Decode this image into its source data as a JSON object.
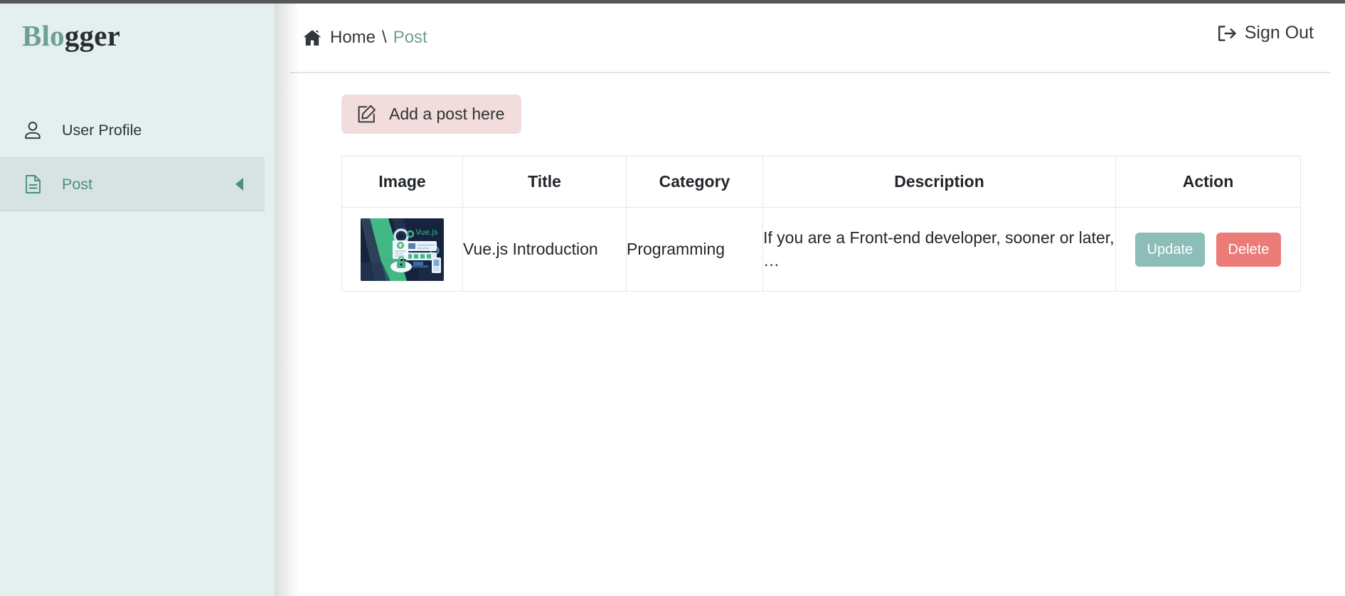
{
  "app": {
    "brand_accent": "Blo",
    "brand_rest": "gger",
    "accent_color": "#6f9e97",
    "sidebar_bg": "#e4f0ee",
    "active_item_bg": "#d7e3e1"
  },
  "sidebar": {
    "items": [
      {
        "label": "User Profile",
        "icon": "user-icon",
        "active": false
      },
      {
        "label": "Post",
        "icon": "file-icon",
        "active": true,
        "caret": "caret-left-icon"
      }
    ]
  },
  "header": {
    "breadcrumb": {
      "home_icon": "home-icon",
      "home": "Home",
      "separator": "\\",
      "current": "Post"
    },
    "signout": {
      "icon": "sign-out-icon",
      "label": "Sign Out"
    }
  },
  "content": {
    "add_button": {
      "icon": "pen-square-icon",
      "label": "Add a post here",
      "bg": "#f2dcdc"
    },
    "table": {
      "columns": [
        "Image",
        "Title",
        "Category",
        "Description",
        "Action"
      ],
      "rows": [
        {
          "image_alt": "Vue.js Introduction thumbnail",
          "image_caption": "Vue.js",
          "title": "Vue.js Introduction",
          "category": "Programming",
          "description": "If you are a Front-end developer, sooner or later, …",
          "actions": [
            {
              "label": "Update",
              "color": "#8cbdb9"
            },
            {
              "label": "Delete",
              "color": "#ea7b77"
            }
          ]
        }
      ]
    }
  }
}
